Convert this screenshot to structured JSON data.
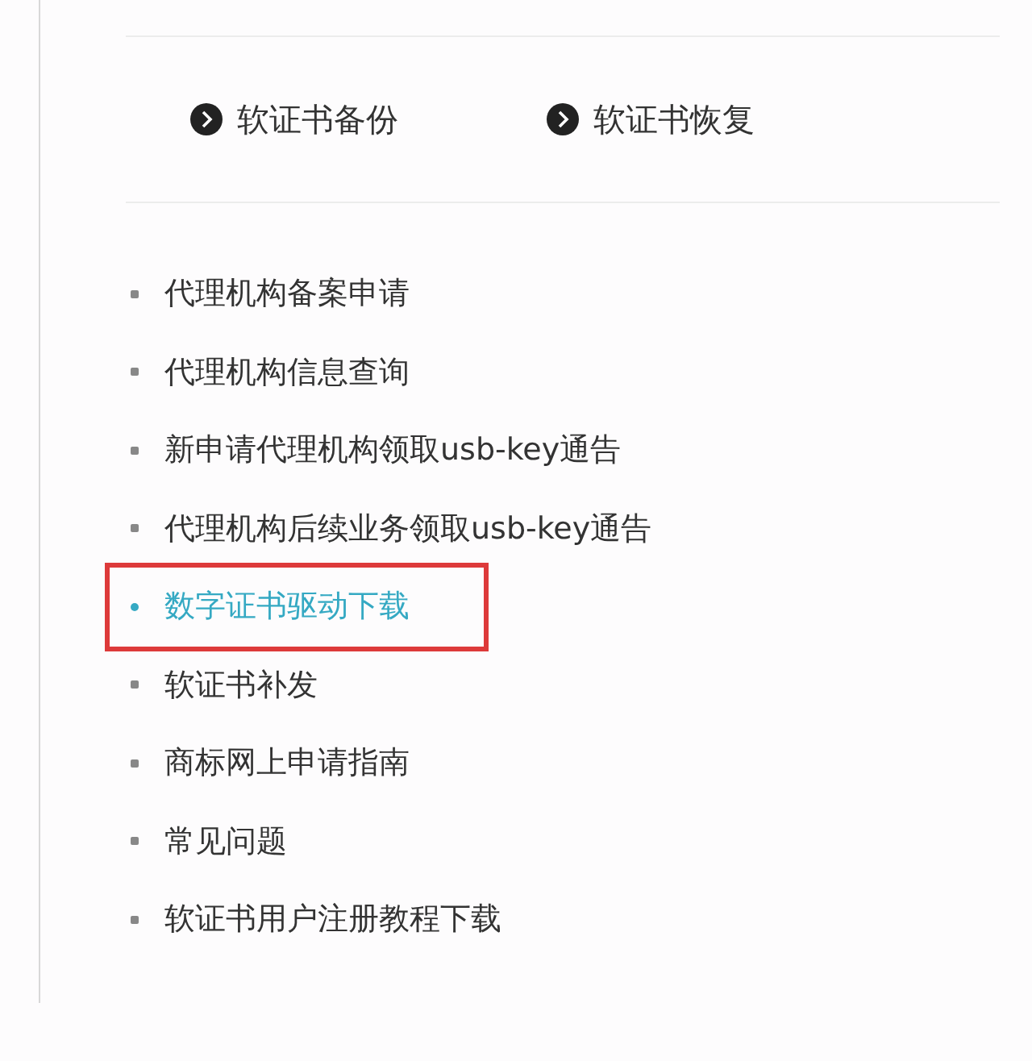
{
  "actions": [
    {
      "label": "软证书备份"
    },
    {
      "label": "软证书恢复"
    }
  ],
  "links": [
    {
      "label": "代理机构备案申请",
      "selected": false
    },
    {
      "label": "代理机构信息查询",
      "selected": false
    },
    {
      "label": "新申请代理机构领取usb-key通告",
      "selected": false
    },
    {
      "label": "代理机构后续业务领取usb-key通告",
      "selected": false
    },
    {
      "label": "数字证书驱动下载",
      "selected": true
    },
    {
      "label": "软证书补发",
      "selected": false
    },
    {
      "label": "商标网上申请指南",
      "selected": false
    },
    {
      "label": "常见问题",
      "selected": false
    },
    {
      "label": "软证书用户注册教程下载",
      "selected": false
    }
  ]
}
